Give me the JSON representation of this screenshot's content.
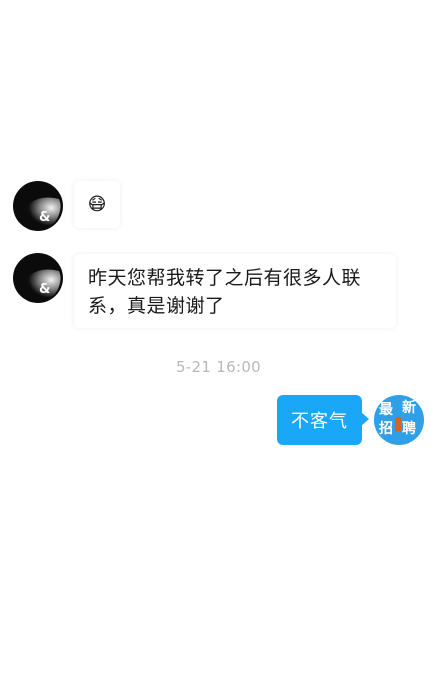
{
  "messages": {
    "incoming_1": {
      "emoji": "😷",
      "emoji_name": "face-emoji"
    },
    "incoming_2": {
      "line1": "昨天您帮我转了之后有很多人联",
      "line2": "系，真是谢谢了"
    },
    "timestamp": "5-21 16:00",
    "outgoing_1": {
      "text": "不客气"
    }
  },
  "self_avatar": {
    "chars": [
      "最",
      "新",
      "招",
      "聘"
    ]
  },
  "colors": {
    "outgoing_bubble": "#1aa7f7",
    "timestamp_text": "#b9b9b9",
    "logo_bg": "#2f9fe8"
  }
}
